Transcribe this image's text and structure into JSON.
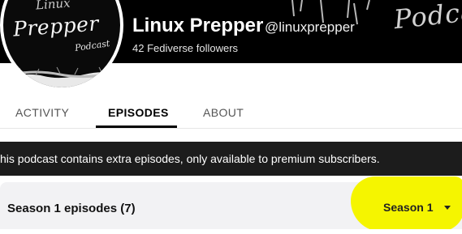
{
  "banner": {
    "art_text": "Podca"
  },
  "avatar": {
    "title_top": "Linux",
    "title": "Prepper",
    "subtitle": "Podcast"
  },
  "channel": {
    "name": "Linux Prepper",
    "handle": "@linuxprepper",
    "followers": "42 Fediverse followers"
  },
  "tabs": [
    {
      "label": "ACTIVITY",
      "active": false
    },
    {
      "label": "EPISODES",
      "active": true
    },
    {
      "label": "ABOUT",
      "active": false
    }
  ],
  "notice": {
    "text": "his podcast contains extra episodes, only available to premium subscribers."
  },
  "season": {
    "heading": "Season 1 episodes (7)",
    "selected": "Season 1",
    "dropdown_icon": "caret-down-icon"
  },
  "colors": {
    "banner_bg": "#000000",
    "notice_bg": "#1c1c1c",
    "season_bar_bg": "#f2f2f4",
    "highlight": "#f5f500",
    "active_tab": "#000000"
  }
}
